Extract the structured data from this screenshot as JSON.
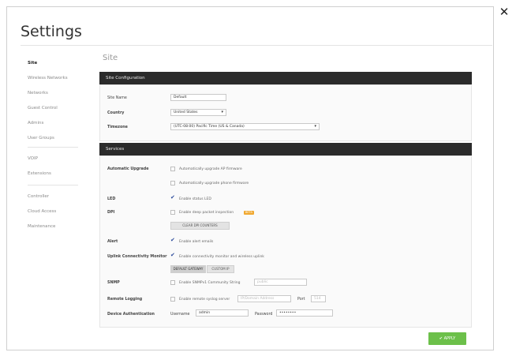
{
  "modal": {
    "title": "Settings",
    "close_glyph": "✕"
  },
  "sidebar": {
    "items": [
      {
        "label": "Site",
        "active": true
      },
      {
        "label": "Wireless Networks"
      },
      {
        "label": "Networks"
      },
      {
        "label": "Guest Control"
      },
      {
        "label": "Admins"
      },
      {
        "label": "User Groups"
      },
      {
        "label": "VOIP"
      },
      {
        "label": "Extensions"
      },
      {
        "label": "Controller"
      },
      {
        "label": "Cloud Access"
      },
      {
        "label": "Maintenance"
      }
    ]
  },
  "site": {
    "section_title": "Site",
    "config_header": "Site Configuration",
    "site_name_label": "Site Name",
    "site_name_value": "Default",
    "country_label": "Country",
    "country_value": "United States",
    "timezone_label": "Timezone",
    "timezone_value": "(UTC-08:00) Pacific Time (US & Canada)"
  },
  "services": {
    "header": "Services",
    "automatic_upgrade_label": "Automatic Upgrade",
    "auto_upgrade_ap": "Automatically upgrade AP firmware",
    "auto_upgrade_phone": "Automatically upgrade phone firmware",
    "led_label": "LED",
    "led_option": "Enable status LED",
    "dpi_label": "DPI",
    "dpi_option": "Enable deep packet inspection",
    "dpi_badge": "BETA",
    "clear_dpi_button": "CLEAR DPI COUNTERS",
    "alert_label": "Alert",
    "alert_option": "Enable alert emails",
    "uplink_label": "Uplink Connectivity Monitor",
    "uplink_option": "Enable connectivity monitor and wireless uplink",
    "default_gateway_button": "DEFAULT GATEWAY",
    "custom_ip_button": "CUSTOM IP",
    "snmp_label": "SNMP",
    "snmp_option": "Enable SNMPv1 Community String",
    "snmp_placeholder": "public",
    "remote_logging_label": "Remote Logging",
    "remote_logging_option": "Enable remote syslog server",
    "remote_host_placeholder": "IP/Domain Address",
    "port_label": "Port",
    "port_placeholder": "514",
    "device_auth_label": "Device Authentication",
    "username_label": "Username",
    "username_value": "admin",
    "password_label": "Password",
    "password_value": "••••••••"
  },
  "footer": {
    "apply_label": "✔ APPLY"
  },
  "colors": {
    "header_bar": "#2b2b2b",
    "apply": "#6cc04a",
    "check": "#2b4a9b",
    "badge": "#f0a830"
  }
}
